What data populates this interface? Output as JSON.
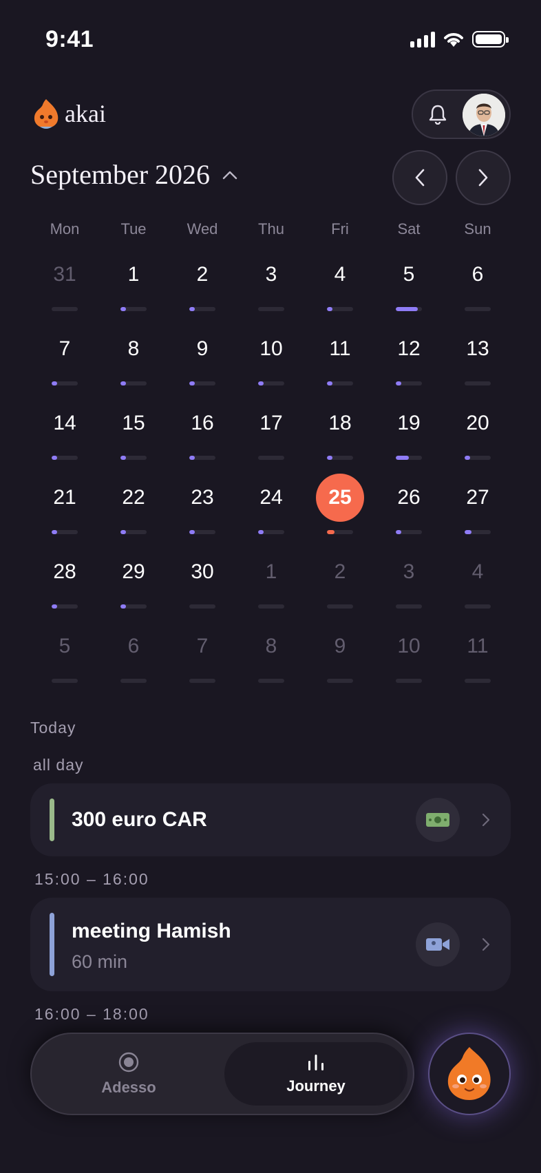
{
  "status_bar": {
    "time": "9:41"
  },
  "header": {
    "brand": "akai"
  },
  "calendar": {
    "month_label": "September 2026",
    "weekdays": [
      "Mon",
      "Tue",
      "Wed",
      "Thu",
      "Fri",
      "Sat",
      "Sun"
    ],
    "days": [
      {
        "n": "31",
        "other": true,
        "level": 0
      },
      {
        "n": "1",
        "level": 0.2
      },
      {
        "n": "2",
        "level": 0.2
      },
      {
        "n": "3",
        "level": 0
      },
      {
        "n": "4",
        "level": 0.2
      },
      {
        "n": "5",
        "level": 0.85
      },
      {
        "n": "6",
        "level": 0
      },
      {
        "n": "7",
        "level": 0.2
      },
      {
        "n": "8",
        "level": 0.2
      },
      {
        "n": "9",
        "level": 0.2
      },
      {
        "n": "10",
        "level": 0.2
      },
      {
        "n": "11",
        "level": 0.2
      },
      {
        "n": "12",
        "level": 0.2
      },
      {
        "n": "13",
        "level": 0
      },
      {
        "n": "14",
        "level": 0.2
      },
      {
        "n": "15",
        "level": 0.2
      },
      {
        "n": "16",
        "level": 0.2
      },
      {
        "n": "17",
        "level": 0
      },
      {
        "n": "18",
        "level": 0.2
      },
      {
        "n": "19",
        "level": 0.5
      },
      {
        "n": "20",
        "level": 0.2
      },
      {
        "n": "21",
        "level": 0.2
      },
      {
        "n": "22",
        "level": 0.2
      },
      {
        "n": "23",
        "level": 0.2
      },
      {
        "n": "24",
        "level": 0.2
      },
      {
        "n": "25",
        "today": true,
        "level": 0.3
      },
      {
        "n": "26",
        "level": 0.2
      },
      {
        "n": "27",
        "level": 0.25
      },
      {
        "n": "28",
        "level": 0.2
      },
      {
        "n": "29",
        "level": 0.2
      },
      {
        "n": "30",
        "level": 0
      },
      {
        "n": "1",
        "other": true,
        "level": 0
      },
      {
        "n": "2",
        "other": true,
        "level": 0
      },
      {
        "n": "3",
        "other": true,
        "level": 0
      },
      {
        "n": "4",
        "other": true,
        "level": 0
      },
      {
        "n": "5",
        "other": true,
        "level": 0
      },
      {
        "n": "6",
        "other": true,
        "level": 0
      },
      {
        "n": "7",
        "other": true,
        "level": 0
      },
      {
        "n": "8",
        "other": true,
        "level": 0
      },
      {
        "n": "9",
        "other": true,
        "level": 0
      },
      {
        "n": "10",
        "other": true,
        "level": 0
      },
      {
        "n": "11",
        "other": true,
        "level": 0
      }
    ]
  },
  "agenda": {
    "section_label": "Today",
    "all_day_label": "all day",
    "events": [
      {
        "title": "300 euro CAR",
        "icon": "money-icon",
        "stripe_color": "#9ab98a"
      },
      {
        "time_label": "15:00 – 16:00",
        "title": "meeting Hamish",
        "subtitle": "60 min",
        "icon": "video-camera-icon",
        "stripe_color": "#8ea2d8"
      }
    ],
    "next_time_label": "16:00 – 18:00"
  },
  "tabbar": {
    "tabs": [
      {
        "label": "Adesso",
        "icon": "target-icon"
      },
      {
        "label": "Journey",
        "icon": "bar-chart-icon",
        "active": true
      }
    ]
  }
}
